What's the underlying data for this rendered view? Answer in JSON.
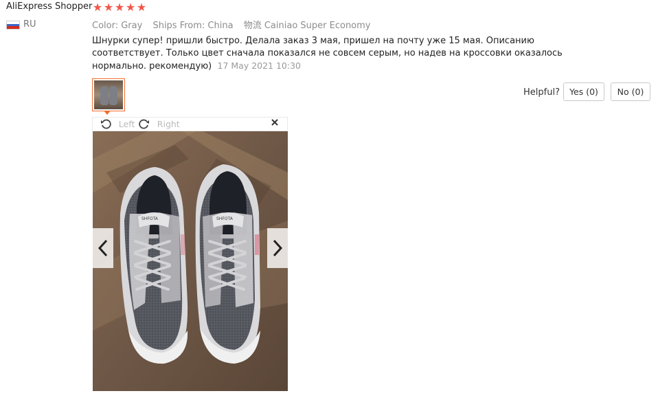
{
  "review": {
    "username": "AliExpress Shopper",
    "country": "RU",
    "rating": 5,
    "star_glyph": "★",
    "meta": {
      "color": "Color: Gray",
      "ships_from": "Ships From: China",
      "logistics": "物流 Cainiao Super Economy"
    },
    "text": "Шнурки супер! пришли быстро. Делала заказ 3 мая, пришел на почту уже 15 мая. Описанию соответствует. Только цвет сначала показался не совсем серым, но надев на кроссовки оказалось нормально. рекомендую)",
    "date": "17 May 2021 10:30"
  },
  "helpful": {
    "label": "Helpful?",
    "yes_label": "Yes (0)",
    "no_label": "No (0)"
  },
  "viewer": {
    "rotate_left_label": "Left",
    "rotate_right_label": "Right",
    "rotate_left_icon": "rotate-left-icon",
    "rotate_right_icon": "rotate-right-icon",
    "close_icon": "close-icon",
    "prev_icon": "chevron-left-icon",
    "next_icon": "chevron-right-icon",
    "shoe_brand_text": "SHFOTA"
  },
  "colors": {
    "star": "#f0574a",
    "thumb_border": "#f56b2a"
  }
}
